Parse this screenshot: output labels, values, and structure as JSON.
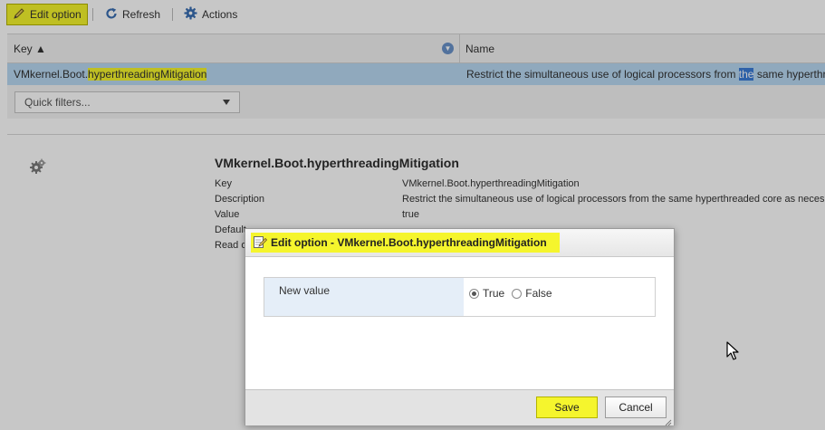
{
  "toolbar": {
    "edit_label": "Edit option",
    "refresh_label": "Refresh",
    "actions_label": "Actions"
  },
  "grid": {
    "columns": {
      "key": "Key ▲",
      "name": "Name"
    },
    "row": {
      "key_prefix": "VMkernel.Boot.",
      "key_highlight": "hyperthreadingMitigation",
      "name_before": "Restrict the simultaneous use of logical processors from ",
      "name_highlight": "the",
      "name_after": " same hyperthr"
    },
    "quick_filters_label": "Quick filters..."
  },
  "detail": {
    "title": "VMkernel.Boot.hyperthreadingMitigation",
    "labels": {
      "key": "Key",
      "description": "Description",
      "value": "Value",
      "default": "Default",
      "read_only": "Read o"
    },
    "values": {
      "key": "VMkernel.Boot.hyperthreadingMitigation",
      "description": "Restrict the simultaneous use of logical processors from the same hyperthreaded core as neces",
      "value": "true"
    }
  },
  "dialog": {
    "title": "Edit option - VMkernel.Boot.hyperthreadingMitigation",
    "field_label": "New value",
    "options": [
      "True",
      "False"
    ],
    "selected": "True",
    "save_label": "Save",
    "cancel_label": "Cancel"
  },
  "colors": {
    "highlight": "#f5f52d",
    "selection_row": "#b9d9f3",
    "text_selection": "#3b7dd8",
    "accent_blue": "#3a6fb3"
  }
}
